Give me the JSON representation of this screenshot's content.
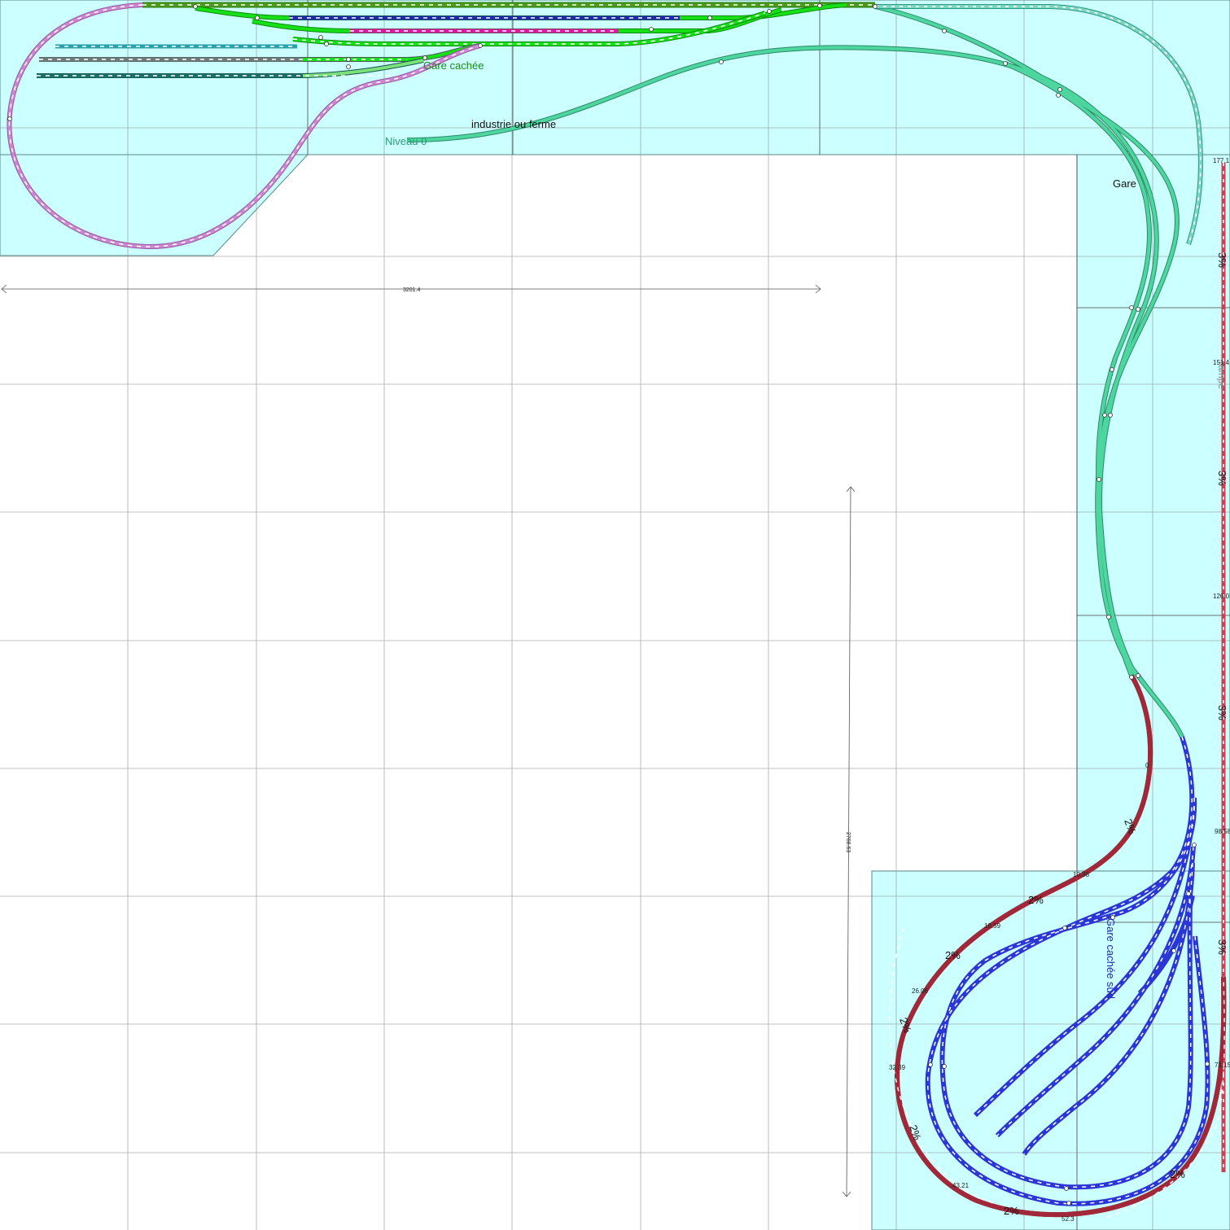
{
  "labels": {
    "gare_cachee": "Gare cachée",
    "industrie": "industrie ou ferme",
    "niveau0": "Niveau 0",
    "gare": "Gare",
    "gare_cachee_sud": "Gare cachée sud",
    "rampe": "rampe"
  },
  "dimensions": {
    "width": "3201.4",
    "height": "2768.63"
  },
  "gradients": {
    "two_pct": "2%",
    "three_pct": "3%"
  },
  "red_heights": [
    "0",
    "10.38",
    "18.59",
    "26.06",
    "32.39",
    "43.21",
    "52.3"
  ],
  "rampe_heights": [
    "177.1",
    "151.4",
    "126.0",
    "98.58",
    "71.15"
  ],
  "colors": {
    "table": "#ccffff",
    "grid": "#888888",
    "main_green": "#4dd69f",
    "hidden_green": "#16e016",
    "dark_green": "#4c9a1c",
    "ramp_red": "#cc3f55",
    "hidden_blue": "#2a37d6",
    "loop_pink": "#cc88d0",
    "teal": "#7dd6c0",
    "navy": "#1e2aa8",
    "magenta": "#dd18a4",
    "cyan_track": "#2aa0aa",
    "grey_track": "#6c7a7a",
    "dark_teal": "#1d6f6a"
  }
}
